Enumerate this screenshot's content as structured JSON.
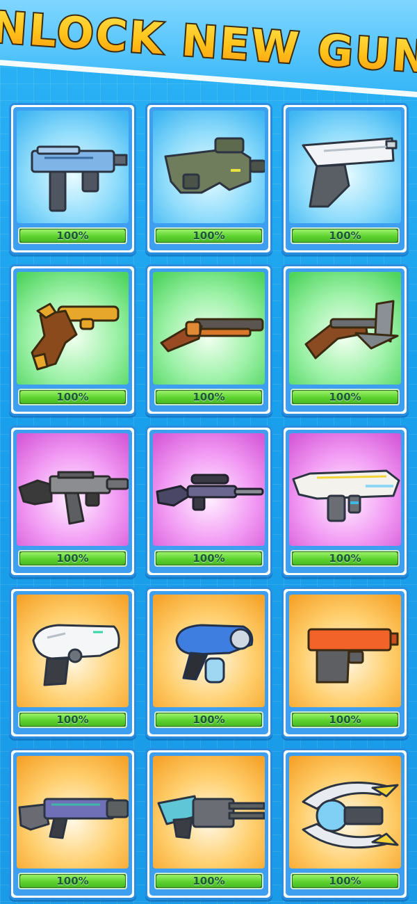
{
  "header": {
    "title": "UNLOCK NEW GUNS"
  },
  "tiers": {
    "blue": [
      "#e8fbff",
      "#8fdcfb",
      "#3fb6f2"
    ],
    "green": [
      "#f2fff0",
      "#9bf1a6",
      "#4fd45e"
    ],
    "purple": [
      "#fff1ff",
      "#f29cf4",
      "#d65ad8"
    ],
    "orange": [
      "#fff8e6",
      "#ffcf6e",
      "#f6a42a"
    ]
  },
  "guns": [
    {
      "icon": "uzi-smg-icon",
      "tier": "blue",
      "progress": 100,
      "label": "100%"
    },
    {
      "icon": "p90-smg-icon",
      "tier": "blue",
      "progress": 100,
      "label": "100%"
    },
    {
      "icon": "desert-eagle-pistol-icon",
      "tier": "blue",
      "progress": 100,
      "label": "100%"
    },
    {
      "icon": "flintlock-pistol-icon",
      "tier": "green",
      "progress": 100,
      "label": "100%"
    },
    {
      "icon": "double-barrel-shotgun-icon",
      "tier": "green",
      "progress": 100,
      "label": "100%"
    },
    {
      "icon": "blunderbuss-axe-icon",
      "tier": "green",
      "progress": 100,
      "label": "100%"
    },
    {
      "icon": "assault-rifle-icon",
      "tier": "purple",
      "progress": 100,
      "label": "100%"
    },
    {
      "icon": "sniper-rifle-icon",
      "tier": "purple",
      "progress": 100,
      "label": "100%"
    },
    {
      "icon": "futuristic-rifle-icon",
      "tier": "purple",
      "progress": 100,
      "label": "100%"
    },
    {
      "icon": "scifi-blaster-icon",
      "tier": "orange",
      "progress": 100,
      "label": "100%"
    },
    {
      "icon": "plasma-pistol-icon",
      "tier": "orange",
      "progress": 100,
      "label": "100%"
    },
    {
      "icon": "orange-pistol-icon",
      "tier": "orange",
      "progress": 100,
      "label": "100%"
    },
    {
      "icon": "scifi-heavy-rifle-icon",
      "tier": "orange",
      "progress": 100,
      "label": "100%"
    },
    {
      "icon": "minigun-cannon-icon",
      "tier": "orange",
      "progress": 100,
      "label": "100%"
    },
    {
      "icon": "claw-blaster-icon",
      "tier": "orange",
      "progress": 100,
      "label": "100%"
    }
  ]
}
